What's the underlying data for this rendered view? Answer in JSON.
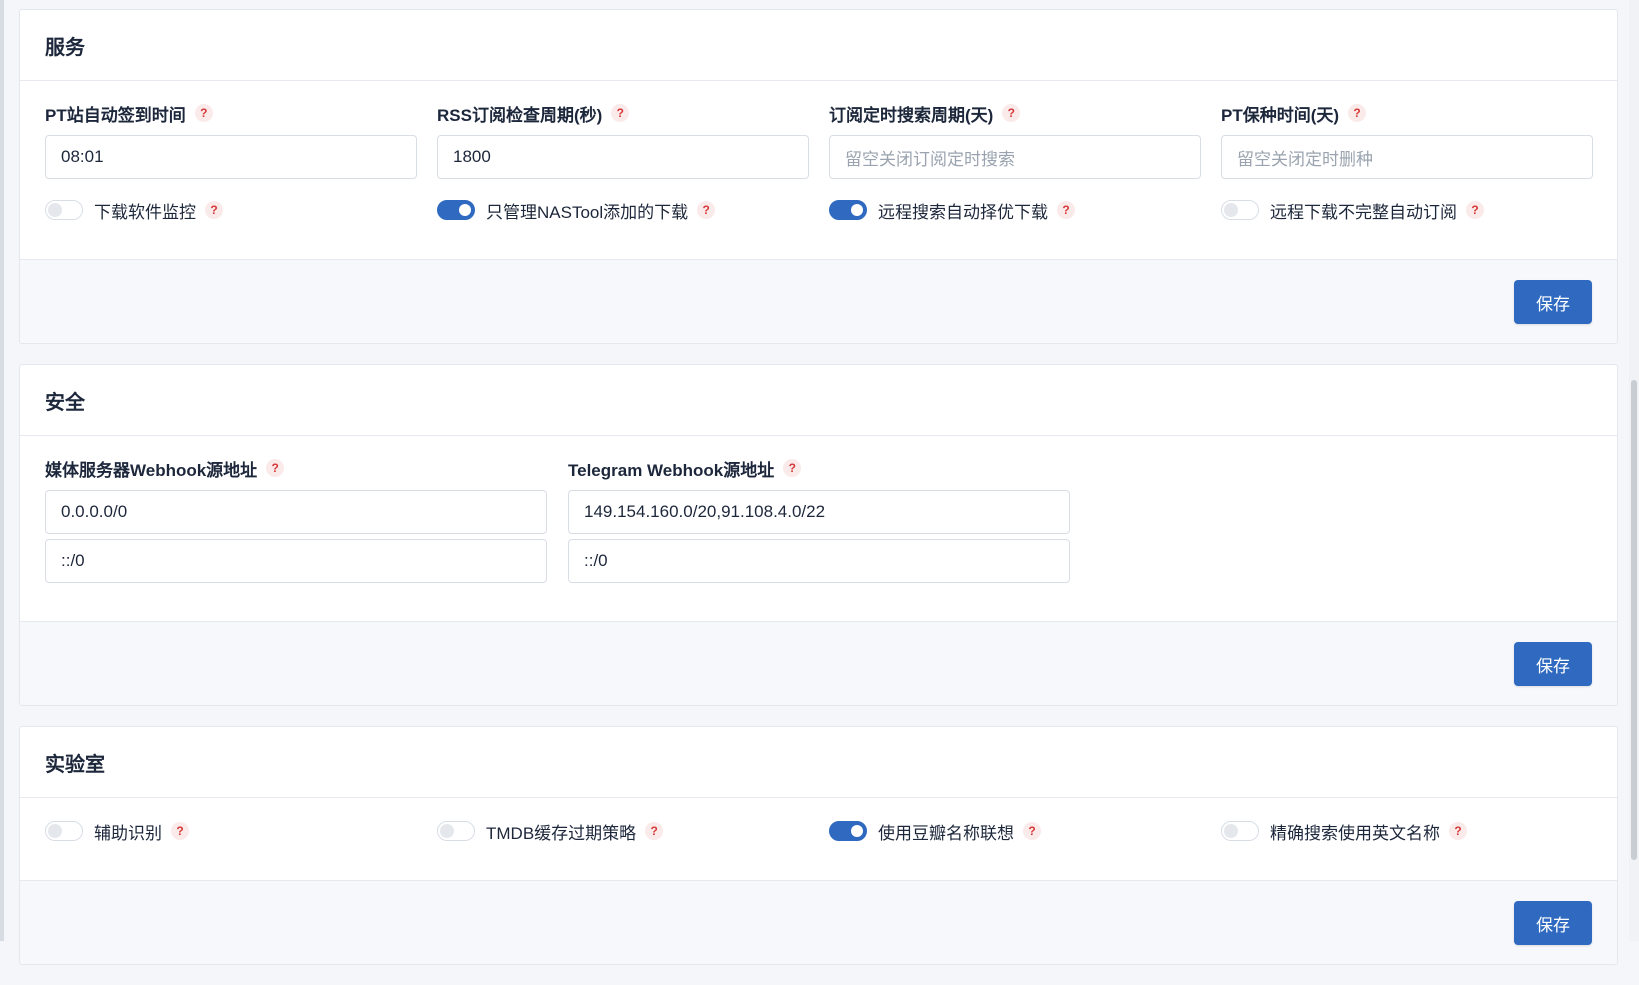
{
  "sections": {
    "service": {
      "title": "服务",
      "fields": [
        {
          "label": "PT站自动签到时间",
          "value": "08:01",
          "placeholder": ""
        },
        {
          "label": "RSS订阅检查周期(秒)",
          "value": "1800",
          "placeholder": ""
        },
        {
          "label": "订阅定时搜索周期(天)",
          "value": "",
          "placeholder": "留空关闭订阅定时搜索"
        },
        {
          "label": "PT保种时间(天)",
          "value": "",
          "placeholder": "留空关闭定时删种"
        }
      ],
      "toggles": [
        {
          "label": "下载软件监控",
          "state": "off"
        },
        {
          "label": "只管理NASTool添加的下载",
          "state": "on"
        },
        {
          "label": "远程搜索自动择优下载",
          "state": "on"
        },
        {
          "label": "远程下载不完整自动订阅",
          "state": "off"
        }
      ],
      "save_label": "保存"
    },
    "security": {
      "title": "安全",
      "media_webhook": {
        "label": "媒体服务器Webhook源地址",
        "values": [
          "0.0.0.0/0",
          "::/0"
        ]
      },
      "telegram_webhook": {
        "label": "Telegram Webhook源地址",
        "values": [
          "149.154.160.0/20,91.108.4.0/22",
          "::/0"
        ]
      },
      "save_label": "保存"
    },
    "lab": {
      "title": "实验室",
      "toggles": [
        {
          "label": "辅助识别",
          "state": "off"
        },
        {
          "label": "TMDB缓存过期策略",
          "state": "off"
        },
        {
          "label": "使用豆瓣名称联想",
          "state": "on"
        },
        {
          "label": "精确搜索使用英文名称",
          "state": "off"
        }
      ],
      "save_label": "保存"
    }
  },
  "help_glyph": "?",
  "colors": {
    "accent": "#2f6ac0",
    "help": "#d63939"
  }
}
